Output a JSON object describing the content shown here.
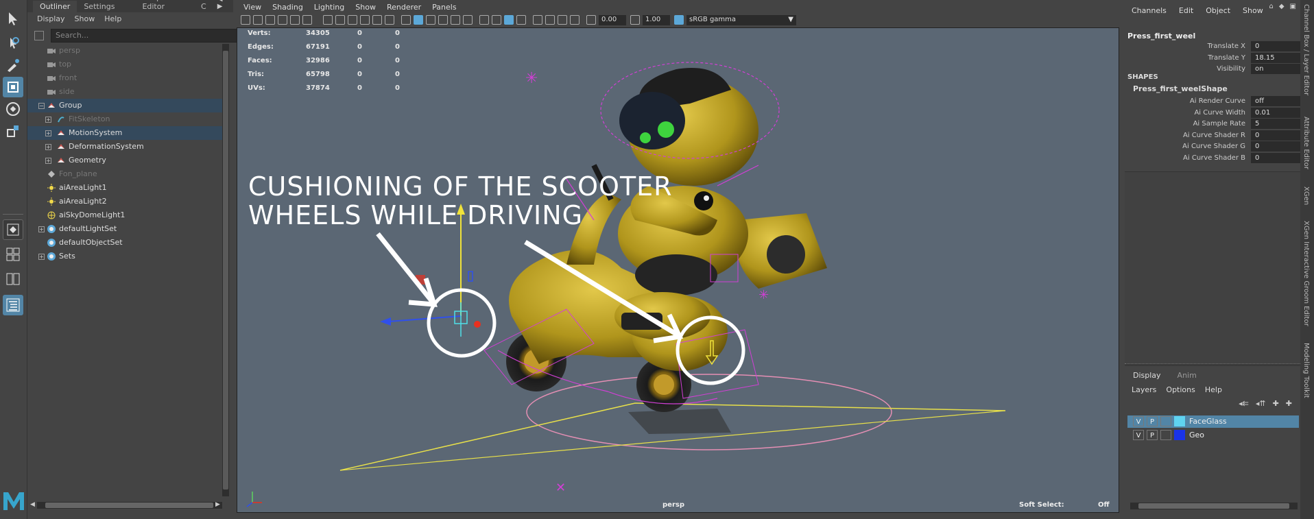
{
  "toolbox": {
    "tools": [
      "select-tool",
      "lasso-tool",
      "paint-select-tool",
      "move-tool",
      "rotate-tool",
      "scale-tool"
    ],
    "layouts": [
      "single-view-layout",
      "four-view-layout",
      "two-view-layout",
      "outliner-layout"
    ]
  },
  "outliner": {
    "tabs": [
      "Outliner",
      "Tool Settings",
      "Shape Editor",
      "C"
    ],
    "menu": [
      "Display",
      "Show",
      "Help"
    ],
    "search_placeholder": "Search...",
    "nodes": [
      {
        "label": "persp",
        "icon": "camera",
        "dim": true,
        "indent": 0
      },
      {
        "label": "top",
        "icon": "camera",
        "dim": true,
        "indent": 0
      },
      {
        "label": "front",
        "icon": "camera",
        "dim": true,
        "indent": 0
      },
      {
        "label": "side",
        "icon": "camera",
        "dim": true,
        "indent": 0
      },
      {
        "label": "Group",
        "icon": "group",
        "expander": "minus",
        "selected": true,
        "indent": 0
      },
      {
        "label": "FitSkeleton",
        "icon": "skeleton",
        "expander": "plus",
        "dim": true,
        "indent": 1
      },
      {
        "label": "MotionSystem",
        "icon": "group",
        "expander": "plus",
        "selected": true,
        "indent": 1
      },
      {
        "label": "DeformationSystem",
        "icon": "group",
        "expander": "plus",
        "indent": 1
      },
      {
        "label": "Geometry",
        "icon": "group",
        "expander": "plus",
        "indent": 1
      },
      {
        "label": "Fon_plane",
        "icon": "mesh",
        "dim": true,
        "indent": 0
      },
      {
        "label": "aiAreaLight1",
        "icon": "light",
        "indent": 0
      },
      {
        "label": "aiAreaLight2",
        "icon": "light",
        "indent": 0
      },
      {
        "label": "aiSkyDomeLight1",
        "icon": "dome",
        "indent": 0
      },
      {
        "label": "defaultLightSet",
        "icon": "set",
        "expander": "plus",
        "indent": 0
      },
      {
        "label": "defaultObjectSet",
        "icon": "set",
        "indent": 0
      },
      {
        "label": "Sets",
        "icon": "set",
        "expander": "plus",
        "indent": 0
      }
    ]
  },
  "viewport": {
    "menu": [
      "View",
      "Shading",
      "Lighting",
      "Show",
      "Renderer",
      "Panels"
    ],
    "exposure": "0.00",
    "gamma": "1.00",
    "color_space": "sRGB gamma",
    "hud": [
      {
        "label": "Verts:",
        "v1": "34305",
        "v2": "0",
        "v3": "0"
      },
      {
        "label": "Edges:",
        "v1": "67191",
        "v2": "0",
        "v3": "0"
      },
      {
        "label": "Faces:",
        "v1": "32986",
        "v2": "0",
        "v3": "0"
      },
      {
        "label": "Tris:",
        "v1": "65798",
        "v2": "0",
        "v3": "0"
      },
      {
        "label": "UVs:",
        "v1": "37874",
        "v2": "0",
        "v3": "0"
      }
    ],
    "camera_label": "persp",
    "soft_select_label": "Soft Select:",
    "soft_select_value": "Off",
    "annotation_line1": "CUSHIONING OF THE SCOOTER",
    "annotation_line2": "WHEELS WHILE DRIVING",
    "colors": {
      "background": "#5b6774",
      "body": "#b59a1e",
      "rig": "#d23fd6",
      "annotation": "#ffffff"
    }
  },
  "channelbox": {
    "menu": [
      "Channels",
      "Edit",
      "Object",
      "Show"
    ],
    "object_name": "Press_first_weel",
    "attributes": [
      {
        "name": "Translate X",
        "value": "0"
      },
      {
        "name": "Translate Y",
        "value": "18.15"
      },
      {
        "name": "Visibility",
        "value": "on"
      }
    ],
    "shapes_header": "SHAPES",
    "shape_name": "Press_first_weelShape",
    "shape_attributes": [
      {
        "name": "Ai Render Curve",
        "value": "off"
      },
      {
        "name": "Ai Curve Width",
        "value": "0.01"
      },
      {
        "name": "Ai Sample Rate",
        "value": "5"
      },
      {
        "name": "Ai Curve Shader R",
        "value": "0"
      },
      {
        "name": "Ai Curve Shader G",
        "value": "0"
      },
      {
        "name": "Ai Curve Shader B",
        "value": "0"
      }
    ]
  },
  "layers": {
    "tabs": [
      "Display",
      "Anim"
    ],
    "menu": [
      "Layers",
      "Options",
      "Help"
    ],
    "rows": [
      {
        "v": "V",
        "p": "P",
        "name": "FaceGlass",
        "color": "#5fd3f0",
        "selected": true
      },
      {
        "v": "V",
        "p": "P",
        "name": "Geo",
        "color": "#1a33e8",
        "selected": false
      }
    ]
  },
  "side_tabs": [
    "Channel Box / Layer Editor",
    "Attribute Editor",
    "XGen",
    "XGen Interactive Groom Editor",
    "Modeling Toolkit"
  ]
}
